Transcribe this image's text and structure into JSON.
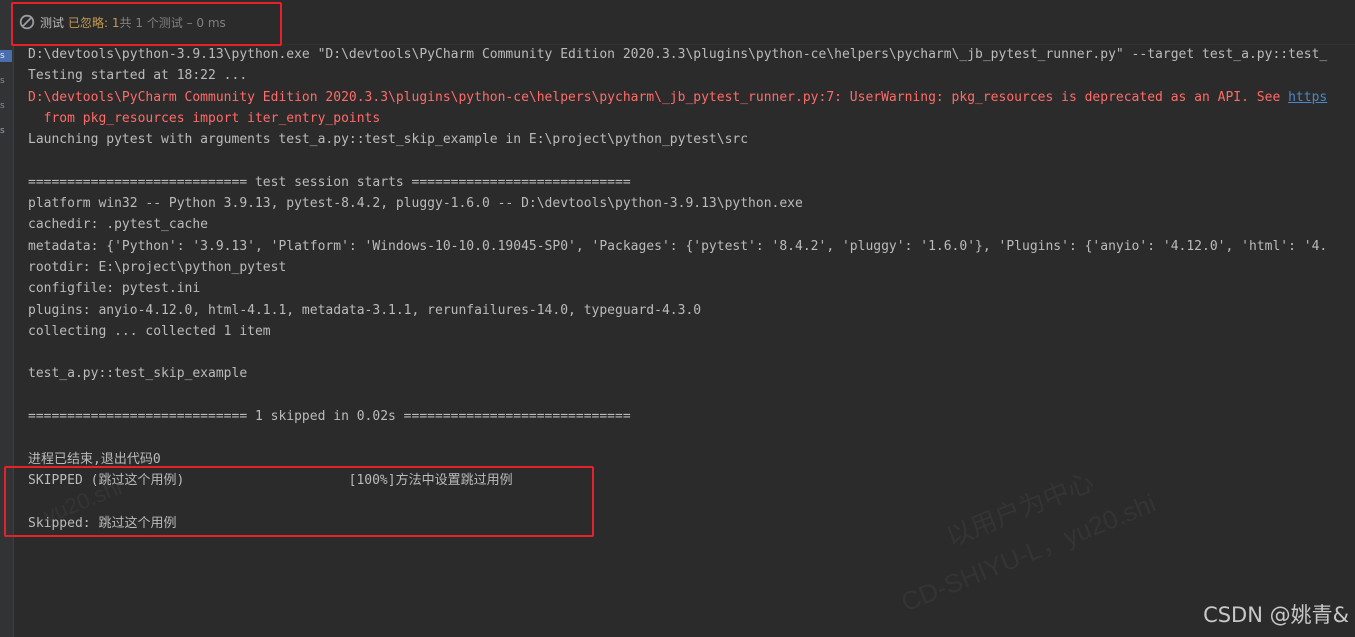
{
  "status": {
    "icon": "ignored-circle-icon",
    "label": "测试",
    "ignored": "已忽略: 1",
    "summary": "共 1 个测试 – 0 ms"
  },
  "gutter": {
    "items": [
      "s",
      "s",
      "s",
      "s",
      "s"
    ]
  },
  "console": {
    "lines": [
      {
        "text": "D:\\devtools\\python-3.9.13\\python.exe \"D:\\devtools\\PyCharm Community Edition 2020.3.3\\plugins\\python-ce\\helpers\\pycharm\\_jb_pytest_runner.py\" --target test_a.py::test_",
        "style": "normal"
      },
      {
        "text": "Testing started at 18:22 ...",
        "style": "normal"
      },
      {
        "text": "D:\\devtools\\PyCharm Community Edition 2020.3.3\\plugins\\python-ce\\helpers\\pycharm\\_jb_pytest_runner.py:7: UserWarning: pkg_resources is deprecated as an API. See ",
        "style": "err",
        "link": "https"
      },
      {
        "text": "  from pkg_resources import iter_entry_points",
        "style": "err"
      },
      {
        "text": "Launching pytest with arguments test_a.py::test_skip_example in E:\\project\\python_pytest\\src",
        "style": "normal"
      },
      {
        "text": "",
        "style": "normal"
      },
      {
        "text": "============================ test session starts ============================",
        "style": "normal"
      },
      {
        "text": "platform win32 -- Python 3.9.13, pytest-8.4.2, pluggy-1.6.0 -- D:\\devtools\\python-3.9.13\\python.exe",
        "style": "normal"
      },
      {
        "text": "cachedir: .pytest_cache",
        "style": "normal"
      },
      {
        "text": "metadata: {'Python': '3.9.13', 'Platform': 'Windows-10-10.0.19045-SP0', 'Packages': {'pytest': '8.4.2', 'pluggy': '1.6.0'}, 'Plugins': {'anyio': '4.12.0', 'html': '4.",
        "style": "normal"
      },
      {
        "text": "rootdir: E:\\project\\python_pytest",
        "style": "normal"
      },
      {
        "text": "configfile: pytest.ini",
        "style": "normal"
      },
      {
        "text": "plugins: anyio-4.12.0, html-4.1.1, metadata-3.1.1, rerunfailures-14.0, typeguard-4.3.0",
        "style": "normal"
      },
      {
        "text": "collecting ... collected 1 item",
        "style": "normal"
      },
      {
        "text": "",
        "style": "normal"
      },
      {
        "text": "test_a.py::test_skip_example",
        "style": "normal"
      },
      {
        "text": "",
        "style": "normal"
      },
      {
        "text": "============================ 1 skipped in 0.02s =============================",
        "style": "normal"
      },
      {
        "text": "",
        "style": "normal"
      },
      {
        "text": "进程已结束,退出代码0",
        "style": "normal"
      },
      {
        "text": "SKIPPED (跳过这个用例)                     [100%]方法中设置跳过用例",
        "style": "normal"
      },
      {
        "text": "",
        "style": "normal"
      },
      {
        "text": "Skipped: 跳过这个用例",
        "style": "normal"
      }
    ]
  },
  "watermarks": [
    "以用户为中心",
    "CD-SHIYU-L，yu20.shi",
    "yu20.shi"
  ],
  "csdn_mark": "CSDN @姚青&",
  "colors": {
    "background": "#2b2b2b",
    "text": "#bbbbbb",
    "error": "#ff6b68",
    "link": "#4a88c7",
    "ignored": "#c49b54",
    "highlight_box": "#e3222c"
  }
}
